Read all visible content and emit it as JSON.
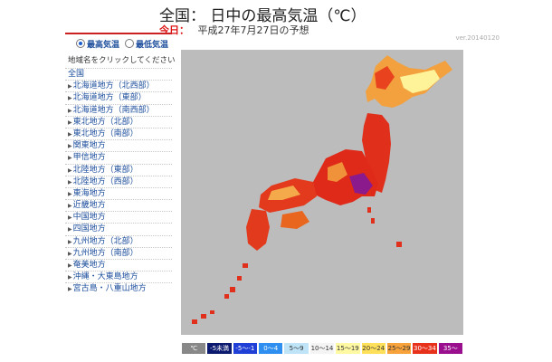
{
  "header": {
    "title": "全国： 日中の最高気温（℃）",
    "today_label": "今日：",
    "forecast_date": "平成27年7月27日の予想"
  },
  "version_label": "ver.20140120",
  "panel": {
    "radio_max": "最高気温",
    "radio_min": "最低気温",
    "instruction": "地域名をクリックしてください",
    "regions": [
      "全国",
      "北海道地方（北西部）",
      "北海道地方（東部）",
      "北海道地方（南西部）",
      "東北地方（北部）",
      "東北地方（南部）",
      "関東地方",
      "甲信地方",
      "北陸地方（東部）",
      "北陸地方（西部）",
      "東海地方",
      "近畿地方",
      "中国地方",
      "四国地方",
      "九州地方（北部）",
      "九州地方（南部）",
      "奄美地方",
      "沖縄・大東島地方",
      "宮古島・八重山地方"
    ]
  },
  "legend": {
    "unit": "℃",
    "items": [
      {
        "label": "-5未満",
        "color": "#0b1a6e",
        "text_color": "#ffffff"
      },
      {
        "label": "-5～-1",
        "color": "#1f3fd6",
        "text_color": "#ffffff"
      },
      {
        "label": "0～4",
        "color": "#2f8ff0",
        "text_color": "#ffffff"
      },
      {
        "label": "5～9",
        "color": "#bfe3f7",
        "text_color": "#333333"
      },
      {
        "label": "10～14",
        "color": "#f4f4f4",
        "text_color": "#333333"
      },
      {
        "label": "15～19",
        "color": "#fff9a3",
        "text_color": "#333333"
      },
      {
        "label": "20～24",
        "color": "#ffe05a",
        "text_color": "#333333"
      },
      {
        "label": "25～29",
        "color": "#f7a23a",
        "text_color": "#333333"
      },
      {
        "label": "30～34",
        "color": "#e8311a",
        "text_color": "#ffffff"
      },
      {
        "label": "35～",
        "color": "#9a0f8e",
        "text_color": "#ffffff"
      }
    ]
  },
  "colors": {
    "background": "#bcbcbc",
    "accent": "#cc1f1f",
    "link": "#1a4c9b"
  }
}
